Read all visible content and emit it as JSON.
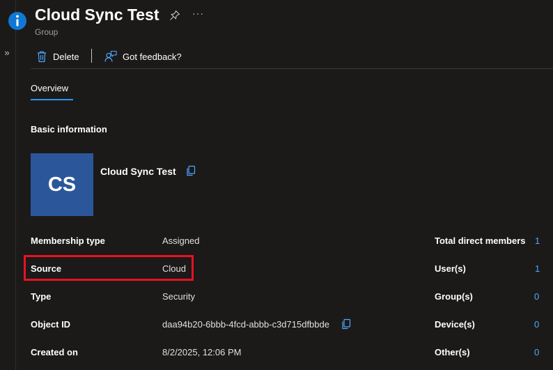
{
  "header": {
    "title": "Cloud Sync Test",
    "subtitle": "Group",
    "more_label": "···"
  },
  "toolbar": {
    "delete_label": "Delete",
    "feedback_label": "Got feedback?"
  },
  "tabs": [
    {
      "label": "Overview",
      "selected": true
    }
  ],
  "basic_info": {
    "section_title": "Basic information",
    "avatar_initials": "CS",
    "group_name": "Cloud Sync Test"
  },
  "properties": [
    {
      "label": "Membership type",
      "value": "Assigned"
    },
    {
      "label": "Source",
      "value": "Cloud"
    },
    {
      "label": "Type",
      "value": "Security"
    },
    {
      "label": "Object ID",
      "value": "daa94b20-6bbb-4fcd-abbb-c3d715dfbbde"
    },
    {
      "label": "Created on",
      "value": "8/2/2025, 12:06 PM"
    }
  ],
  "stats": [
    {
      "label": "Total direct members",
      "value": "1"
    },
    {
      "label": "User(s)",
      "value": "1"
    },
    {
      "label": "Group(s)",
      "value": "0"
    },
    {
      "label": "Device(s)",
      "value": "0"
    },
    {
      "label": "Other(s)",
      "value": "0"
    }
  ],
  "colors": {
    "background": "#1b1a19",
    "accent": "#2899f5",
    "link": "#4ea9ff",
    "avatar": "#2b579a",
    "highlight": "#e81123"
  }
}
